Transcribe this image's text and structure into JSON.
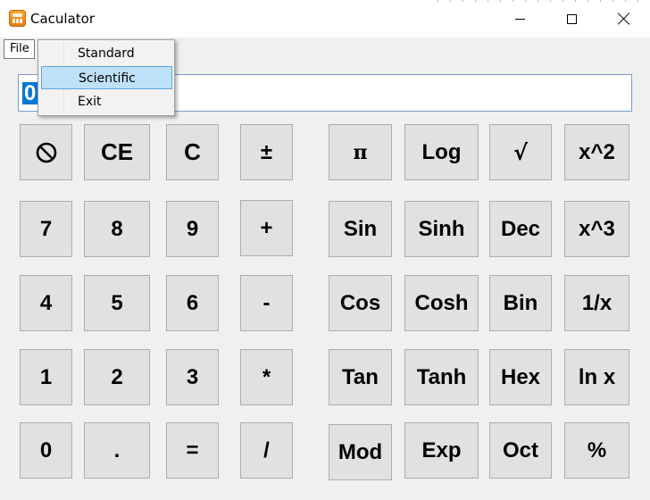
{
  "window": {
    "title": "Caculator",
    "app_icon": "calculator-icon",
    "controls": [
      "minimize-icon",
      "maximize-icon",
      "close-icon"
    ]
  },
  "menubar": {
    "file_label": "File"
  },
  "file_menu": {
    "items": [
      {
        "label": "Standard",
        "selected": false
      },
      {
        "label": "Scientific",
        "selected": true
      },
      {
        "label": "Exit",
        "selected": false
      }
    ]
  },
  "display": {
    "value": "0"
  },
  "buttons": {
    "clear_icon": "prohibited-icon",
    "ce": "CE",
    "c": "C",
    "plus_minus": "±",
    "pi": "π",
    "log": "Log",
    "sqrt": "√",
    "x2": "x^2",
    "n7": "7",
    "n8": "8",
    "n9": "9",
    "plus": "+",
    "sin": "Sin",
    "sinh": "Sinh",
    "dec": "Dec",
    "x3": "x^3",
    "n4": "4",
    "n5": "5",
    "n6": "6",
    "minus": "-",
    "cos": "Cos",
    "cosh": "Cosh",
    "bin": "Bin",
    "inv": "1/x",
    "n1": "1",
    "n2": "2",
    "n3": "3",
    "multiply": "*",
    "tan": "Tan",
    "tanh": "Tanh",
    "hex": "Hex",
    "ln": "ln x",
    "n0": "0",
    "dot": ".",
    "equals": "=",
    "divide": "/",
    "mod": "Mod",
    "exp": "Exp",
    "oct": "Oct",
    "percent": "%"
  },
  "colors": {
    "selection_blue": "#0078d7",
    "menu_highlight": "#bee1f8",
    "button_face": "#e1e1e1",
    "window_bg": "#f0f0f0"
  }
}
